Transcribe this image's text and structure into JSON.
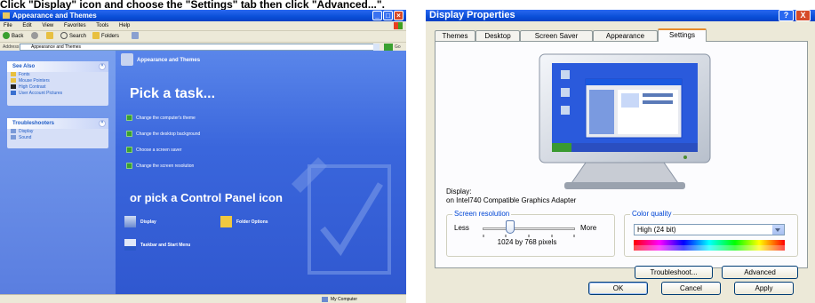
{
  "caption": {
    "text": "Click \"Display\" icon and choose the \"Settings\" tab then click \"Advanced...\"."
  },
  "control_panel": {
    "title": "Appearance and Themes",
    "menu": [
      "File",
      "Edit",
      "View",
      "Favorites",
      "Tools",
      "Help"
    ],
    "toolbar": {
      "back": "Back",
      "search": "Search",
      "folders": "Folders"
    },
    "address_label": "Address",
    "address_value": "Appearance and Themes",
    "go_label": "Go",
    "see_also": {
      "title": "See Also",
      "items": [
        "Fonts",
        "Mouse Pointers",
        "High Contrast",
        "User Account Pictures"
      ]
    },
    "troubleshooters": {
      "title": "Troubleshooters",
      "items": [
        "Display",
        "Sound"
      ]
    },
    "header": "Appearance and Themes",
    "pick_task": "Pick a task...",
    "tasks": [
      "Change the computer's theme",
      "Change the desktop background",
      "Choose a screen saver",
      "Change the screen resolution"
    ],
    "or_pick": "or pick a Control Panel icon",
    "icons": [
      "Display",
      "Folder Options",
      "Taskbar and Start Menu"
    ],
    "status": "My Computer"
  },
  "display_properties": {
    "title": "Display Properties",
    "help_label": "?",
    "close_label": "X",
    "tabs": [
      "Themes",
      "Desktop",
      "Screen Saver",
      "Appearance",
      "Settings"
    ],
    "active_tab": "Settings",
    "display_label": "Display:",
    "display_value": "on Intel740 Compatible Graphics Adapter",
    "screen_resolution": {
      "label": "Screen resolution",
      "less": "Less",
      "more": "More",
      "value": "1024 by 768 pixels",
      "slider_fraction": 0.3
    },
    "color_quality": {
      "label": "Color quality",
      "value": "High (24 bit)"
    },
    "buttons": {
      "troubleshoot": "Troubleshoot...",
      "advanced": "Advanced",
      "ok": "OK",
      "cancel": "Cancel",
      "apply": "Apply"
    }
  }
}
